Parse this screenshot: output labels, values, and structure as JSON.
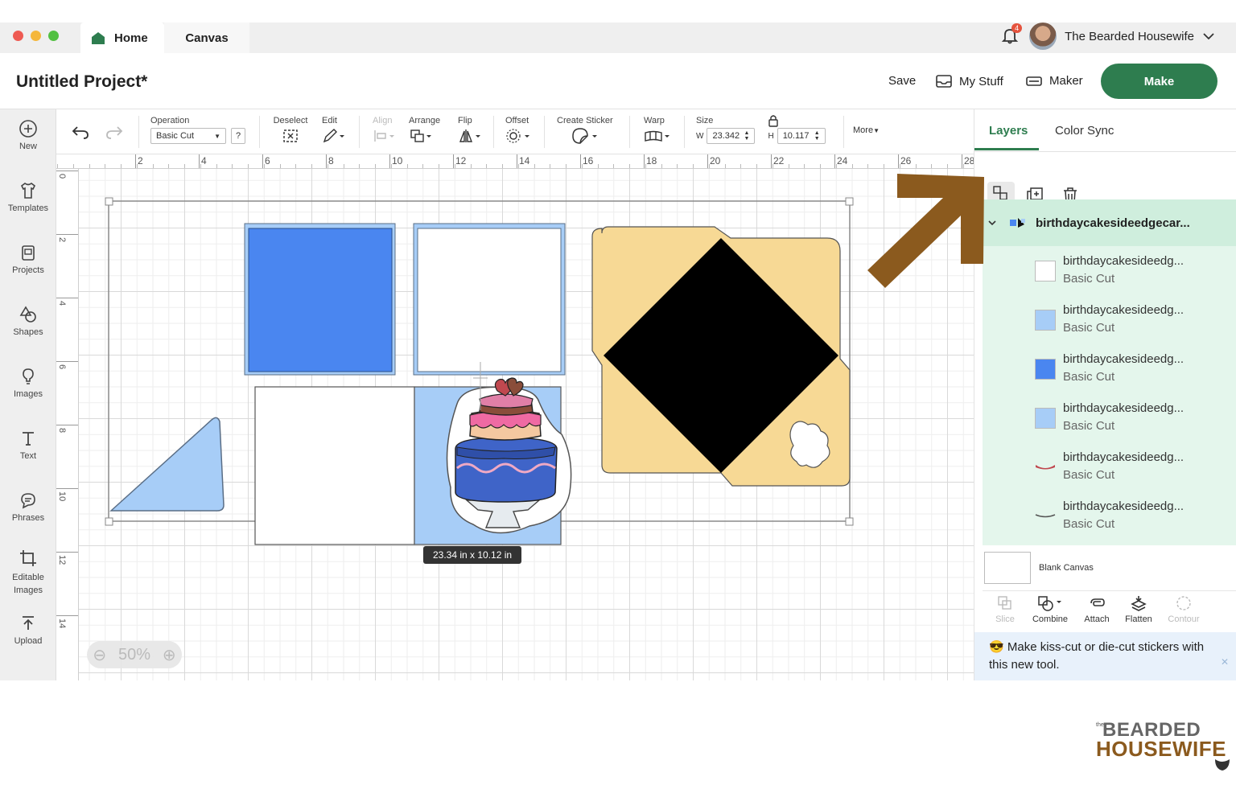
{
  "tabs": {
    "home": "Home",
    "canvas": "Canvas"
  },
  "account": {
    "name": "The Bearded Housewife",
    "notifications": "4"
  },
  "header": {
    "project_title": "Untitled Project*",
    "save": "Save",
    "my_stuff": "My Stuff",
    "maker": "Maker",
    "make": "Make"
  },
  "sidebar": [
    {
      "label": "New",
      "icon": "plus-circle-icon"
    },
    {
      "label": "Templates",
      "icon": "shirt-icon"
    },
    {
      "label": "Projects",
      "icon": "projects-icon"
    },
    {
      "label": "Shapes",
      "icon": "shapes-icon"
    },
    {
      "label": "Images",
      "icon": "lightbulb-icon"
    },
    {
      "label": "Text",
      "icon": "text-icon"
    },
    {
      "label": "Phrases",
      "icon": "speech-bubble-icon"
    },
    {
      "label": "Editable Images",
      "icon": "crop-icon"
    },
    {
      "label": "Upload",
      "icon": "upload-icon"
    }
  ],
  "toolbar": {
    "operation_label": "Operation",
    "operation_value": "Basic Cut",
    "help": "?",
    "deselect": "Deselect",
    "edit": "Edit",
    "align": "Align",
    "arrange": "Arrange",
    "flip": "Flip",
    "offset": "Offset",
    "create_sticker": "Create Sticker",
    "warp": "Warp",
    "size": "Size",
    "w_label": "W",
    "w_value": "23.342",
    "h_label": "H",
    "h_value": "10.117",
    "more": "More"
  },
  "ruler": {
    "h_ticks": [
      "2",
      "4",
      "6",
      "8",
      "10",
      "12",
      "14",
      "16",
      "18",
      "20",
      "22",
      "24",
      "26",
      "28"
    ],
    "v_ticks": [
      "0",
      "2",
      "4",
      "6",
      "8",
      "10",
      "12",
      "14"
    ]
  },
  "canvas": {
    "size_tooltip": "23.34  in x 10.12  in",
    "zoom": "50%"
  },
  "panel": {
    "tab_layers": "Layers",
    "tab_color_sync": "Color Sync",
    "group_name": "birthdaycakesideedgecar...",
    "layers": [
      {
        "name": "birthdaycakesideedg...",
        "op": "Basic Cut",
        "color": "#ffffff"
      },
      {
        "name": "birthdaycakesideedg...",
        "op": "Basic Cut",
        "color": "#a7cdf7"
      },
      {
        "name": "birthdaycakesideedg...",
        "op": "Basic Cut",
        "color": "#4a86f0"
      },
      {
        "name": "birthdaycakesideedg...",
        "op": "Basic Cut",
        "color": "#a7cdf7"
      },
      {
        "name": "birthdaycakesideedg...",
        "op": "Basic Cut",
        "color": "#c0484f"
      },
      {
        "name": "birthdaycakesideedg...",
        "op": "Basic Cut",
        "color": "#555555"
      }
    ],
    "blank_canvas": "Blank Canvas",
    "tools": [
      "Slice",
      "Combine",
      "Attach",
      "Flatten",
      "Contour"
    ],
    "notice_line1": "Make kiss-cut or die-cut stickers with",
    "notice_line2": "this new tool."
  },
  "brand": {
    "line1": "BEARDED",
    "line2": "HOUSEWIFE",
    "prefix": "the"
  },
  "colors": {
    "accent": "#2e7d4f",
    "blue": "#4a86f0",
    "light_blue": "#a7cdf7",
    "envelope": "#f7d995",
    "arrow": "#8b5a1e"
  }
}
